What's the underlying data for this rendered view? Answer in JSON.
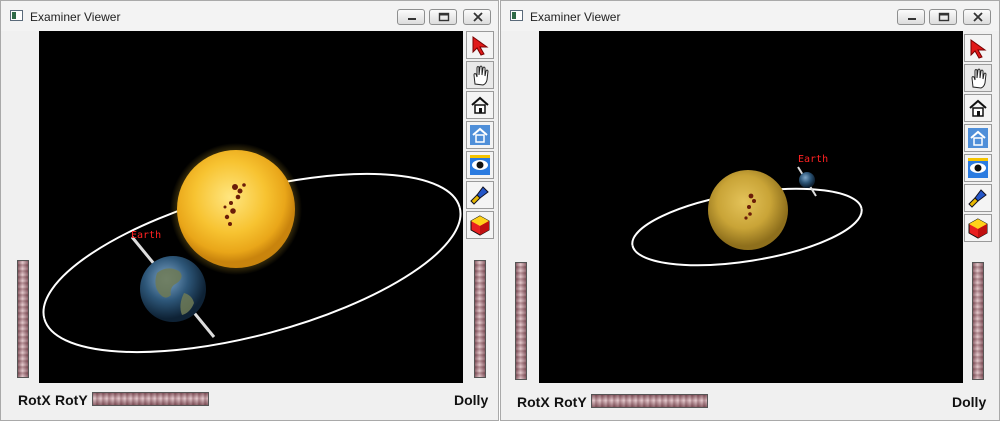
{
  "windows": [
    {
      "title": "Examiner Viewer",
      "labels": {
        "rot_x": "RotX",
        "rot_y": "RotY",
        "dolly": "Dolly"
      },
      "scene": {
        "planet_label": "Earth"
      }
    },
    {
      "title": "Examiner Viewer",
      "labels": {
        "rot_x": "RotX",
        "rot_y": "RotY",
        "dolly": "Dolly"
      },
      "scene": {
        "planet_label": "Earth"
      }
    }
  ],
  "toolbar_icons": [
    "select-arrow-icon",
    "hand-view-icon",
    "home-icon",
    "set-home-icon",
    "view-all-icon",
    "seek-icon",
    "projection-icon"
  ],
  "colors": {
    "viewport_bg": "#000000",
    "sun": "#f4c430",
    "orbit": "#ffffff",
    "earth_label": "#ff2222",
    "thumbwheel": "#c8a2a8"
  }
}
